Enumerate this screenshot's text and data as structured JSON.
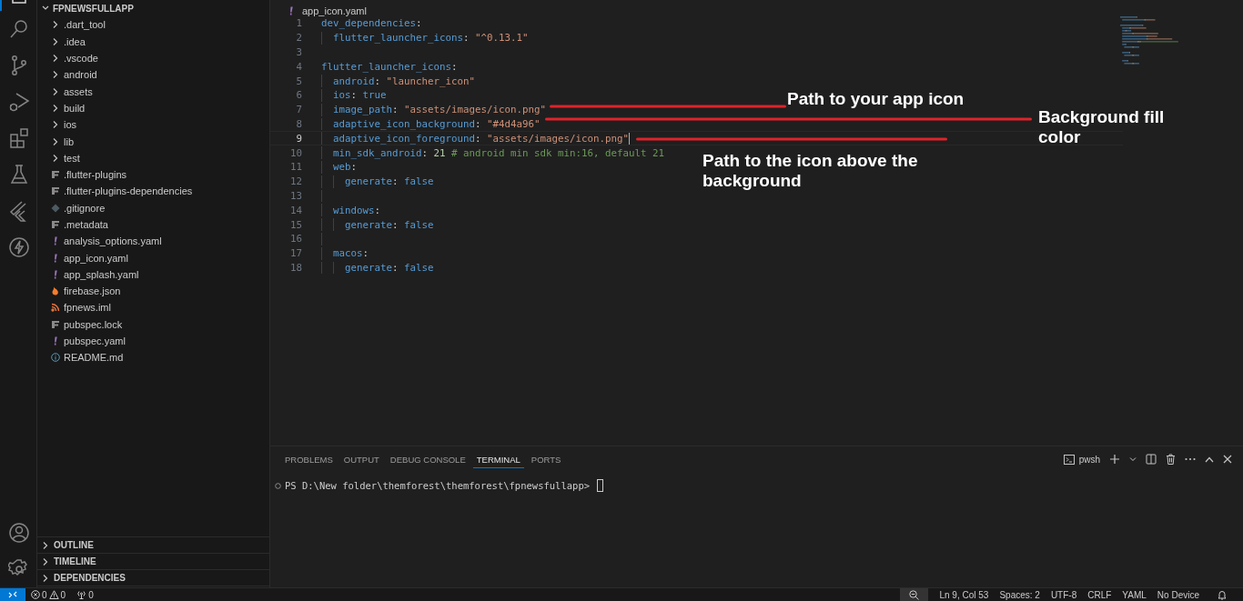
{
  "activity_bar": {
    "top": [
      {
        "kind": "files",
        "selected": true
      },
      {
        "kind": "search",
        "selected": false
      },
      {
        "kind": "branch",
        "selected": false
      },
      {
        "kind": "debug",
        "selected": false
      },
      {
        "kind": "blocks",
        "selected": false
      },
      {
        "kind": "flask",
        "selected": false
      },
      {
        "kind": "flutter",
        "selected": false
      },
      {
        "kind": "bolt",
        "selected": false
      }
    ],
    "bottom": [
      {
        "kind": "account"
      },
      {
        "kind": "gear"
      }
    ]
  },
  "explorer": {
    "root": {
      "label": "FPNEWSFULLAPP",
      "expanded": true
    },
    "items": [
      {
        "label": ".dart_tool",
        "kind": "folder"
      },
      {
        "label": ".idea",
        "kind": "folder"
      },
      {
        "label": ".vscode",
        "kind": "folder"
      },
      {
        "label": "android",
        "kind": "folder"
      },
      {
        "label": "assets",
        "kind": "folder"
      },
      {
        "label": "build",
        "kind": "folder"
      },
      {
        "label": "ios",
        "kind": "folder"
      },
      {
        "label": "lib",
        "kind": "folder"
      },
      {
        "label": "test",
        "kind": "folder"
      },
      {
        "label": ".flutter-plugins",
        "kind": "lines"
      },
      {
        "label": ".flutter-plugins-dependencies",
        "kind": "lines"
      },
      {
        "label": ".gitignore",
        "kind": "git"
      },
      {
        "label": ".metadata",
        "kind": "lines"
      },
      {
        "label": "analysis_options.yaml",
        "kind": "yaml"
      },
      {
        "label": "app_icon.yaml",
        "kind": "yaml"
      },
      {
        "label": "app_splash.yaml",
        "kind": "yaml"
      },
      {
        "label": "firebase.json",
        "kind": "flame"
      },
      {
        "label": "fpnews.iml",
        "kind": "rss"
      },
      {
        "label": "pubspec.lock",
        "kind": "lines"
      },
      {
        "label": "pubspec.yaml",
        "kind": "yaml"
      },
      {
        "label": "README.md",
        "kind": "info"
      }
    ],
    "sections": [
      {
        "label": "OUTLINE",
        "expanded": false
      },
      {
        "label": "TIMELINE",
        "expanded": false
      },
      {
        "label": "DEPENDENCIES",
        "expanded": false
      }
    ]
  },
  "editor": {
    "tab": {
      "label": "app_icon.yaml",
      "kind": "yaml"
    },
    "lines": [
      {
        "number": "1",
        "kind": "top",
        "current": false,
        "tokens": [
          {
            "kind": "key",
            "text": "dev_dependencies"
          },
          {
            "kind": "punct",
            "text": ":"
          }
        ]
      },
      {
        "number": "2",
        "kind": "nested",
        "current": false,
        "tokens": [
          {
            "kind": "key",
            "text": "flutter_launcher_icons"
          },
          {
            "kind": "punct",
            "text": ": "
          },
          {
            "kind": "string",
            "text": "\"^0.13.1\""
          }
        ]
      },
      {
        "number": "3",
        "kind": "top",
        "current": false
      },
      {
        "number": "4",
        "kind": "top",
        "current": false,
        "tokens": [
          {
            "kind": "key",
            "text": "flutter_launcher_icons"
          },
          {
            "kind": "punct",
            "text": ":"
          }
        ]
      },
      {
        "number": "5",
        "kind": "nested",
        "current": false,
        "tokens": [
          {
            "kind": "key",
            "text": "android"
          },
          {
            "kind": "punct",
            "text": ": "
          },
          {
            "kind": "string",
            "text": "\"launcher_icon\""
          }
        ]
      },
      {
        "number": "6",
        "kind": "nested",
        "current": false,
        "tokens": [
          {
            "kind": "key",
            "text": "ios"
          },
          {
            "kind": "punct",
            "text": ": "
          },
          {
            "kind": "bool",
            "text": "true"
          }
        ]
      },
      {
        "number": "7",
        "kind": "nested",
        "current": false,
        "tokens": [
          {
            "kind": "key",
            "text": "image_path"
          },
          {
            "kind": "punct",
            "text": ": "
          },
          {
            "kind": "string",
            "text": "\"assets/images/icon.png\""
          }
        ]
      },
      {
        "number": "8",
        "kind": "nested",
        "current": false,
        "tokens": [
          {
            "kind": "key",
            "text": "adaptive_icon_background"
          },
          {
            "kind": "punct",
            "text": ": "
          },
          {
            "kind": "string",
            "text": "\"#4d4a96\""
          }
        ]
      },
      {
        "number": "9",
        "kind": "nested",
        "current": true,
        "tokens": [
          {
            "kind": "key",
            "text": "adaptive_icon_foreground"
          },
          {
            "kind": "punct",
            "text": ": "
          },
          {
            "kind": "string",
            "text": "\"assets/images/icon.png\""
          }
        ]
      },
      {
        "number": "10",
        "kind": "nested",
        "current": false,
        "tokens": [
          {
            "kind": "key",
            "text": "min_sdk_android"
          },
          {
            "kind": "punct",
            "text": ": "
          },
          {
            "kind": "number",
            "text": "21"
          },
          {
            "kind": "comment",
            "text": " # android min sdk min:16, default 21"
          }
        ]
      },
      {
        "number": "11",
        "kind": "nested",
        "current": false,
        "tokens": [
          {
            "kind": "key",
            "text": "web"
          },
          {
            "kind": "punct",
            "text": ":"
          }
        ]
      },
      {
        "number": "12",
        "kind": "nested2",
        "current": false,
        "tokens": [
          {
            "kind": "key",
            "text": "generate"
          },
          {
            "kind": "punct",
            "text": ": "
          },
          {
            "kind": "bool",
            "text": "false"
          }
        ]
      },
      {
        "number": "13",
        "kind": "nested",
        "current": false
      },
      {
        "number": "14",
        "kind": "nested",
        "current": false,
        "tokens": [
          {
            "kind": "key",
            "text": "windows"
          },
          {
            "kind": "punct",
            "text": ":"
          }
        ]
      },
      {
        "number": "15",
        "kind": "nested2",
        "current": false,
        "tokens": [
          {
            "kind": "key",
            "text": "generate"
          },
          {
            "kind": "punct",
            "text": ": "
          },
          {
            "kind": "bool",
            "text": "false"
          }
        ]
      },
      {
        "number": "16",
        "kind": "nested",
        "current": false
      },
      {
        "number": "17",
        "kind": "nested",
        "current": false,
        "tokens": [
          {
            "kind": "key",
            "text": "macos"
          },
          {
            "kind": "punct",
            "text": ":"
          }
        ]
      },
      {
        "number": "18",
        "kind": "nested2",
        "current": false,
        "tokens": [
          {
            "kind": "key",
            "text": "generate"
          },
          {
            "kind": "punct",
            "text": ": "
          },
          {
            "kind": "bool",
            "text": "false"
          }
        ]
      }
    ],
    "annotations": [
      {
        "text": "Path to your app icon"
      },
      {
        "text": "Background fill color"
      },
      {
        "text": "Path to the icon above the background"
      }
    ]
  },
  "panel": {
    "tabs": [
      {
        "label": "PROBLEMS",
        "selected": false
      },
      {
        "label": "OUTPUT",
        "selected": false
      },
      {
        "label": "DEBUG CONSOLE",
        "selected": false
      },
      {
        "label": "TERMINAL",
        "selected": true
      },
      {
        "label": "PORTS",
        "selected": false
      }
    ],
    "shell": "pwsh",
    "prompt": "PS D:\\New folder\\themforest\\themforest\\fpnewsfullapp>"
  },
  "status_bar": {
    "errors": "0",
    "warnings": "0",
    "ports": "0",
    "right": [
      {
        "kind": "zoom"
      },
      {
        "kind": "text",
        "text": "Ln 9, Col 53"
      },
      {
        "kind": "text",
        "text": "Spaces: 2"
      },
      {
        "kind": "text",
        "text": "UTF-8"
      },
      {
        "kind": "text",
        "text": "CRLF"
      },
      {
        "kind": "text",
        "text": "YAML"
      },
      {
        "kind": "text",
        "text": "No Device"
      },
      {
        "kind": "bell"
      }
    ]
  }
}
